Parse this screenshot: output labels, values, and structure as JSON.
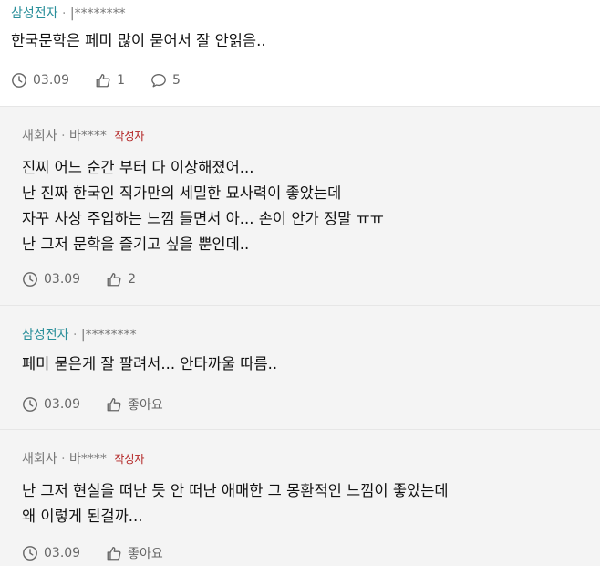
{
  "comments": [
    {
      "company": "삼성전자",
      "sep": "·",
      "user": "|********",
      "author_tag": "",
      "lines": [
        "한국문학은 페미 많이 묻어서 잘 안읽음.."
      ],
      "date": "03.09",
      "likes": "1",
      "replies": "5"
    },
    {
      "company": "새회사",
      "sep": "·",
      "user": "바****",
      "author_tag": "작성자",
      "lines": [
        "진찌 어느 순간 부터 다 이상해졌어...",
        "난 진짜 한국인 직가만의 세밀한 묘사력이 좋았는데",
        "자꾸 사상 주입하는 느낌 들면서 아... 손이 안가 정말 ㅠㅠ",
        "난 그저 문학을 즐기고 싶을 뿐인데.."
      ],
      "date": "03.09",
      "likes": "2"
    },
    {
      "company": "삼성전자",
      "sep": "·",
      "user": "|********",
      "author_tag": "",
      "lines": [
        "페미 묻은게 잘 팔려서... 안타까울 따름.."
      ],
      "date": "03.09",
      "likes": "좋아요"
    },
    {
      "company": "새회사",
      "sep": "·",
      "user": "바****",
      "author_tag": "작성자",
      "lines": [
        "난 그저 현실을 떠난 듯 안 떠난 애매한 그 몽환적인 느낌이 좋았는데",
        "왜 이렇게 된걸까..."
      ],
      "date": "03.09",
      "likes": "좋아요"
    }
  ],
  "colors": {
    "company_accent": "#2a8f9a",
    "author_tag": "#b22222",
    "reply_background": "#f4f4f4"
  },
  "icons": {
    "date": "clock-icon",
    "like": "thumbs-up-icon",
    "reply": "speech-bubble-icon"
  }
}
